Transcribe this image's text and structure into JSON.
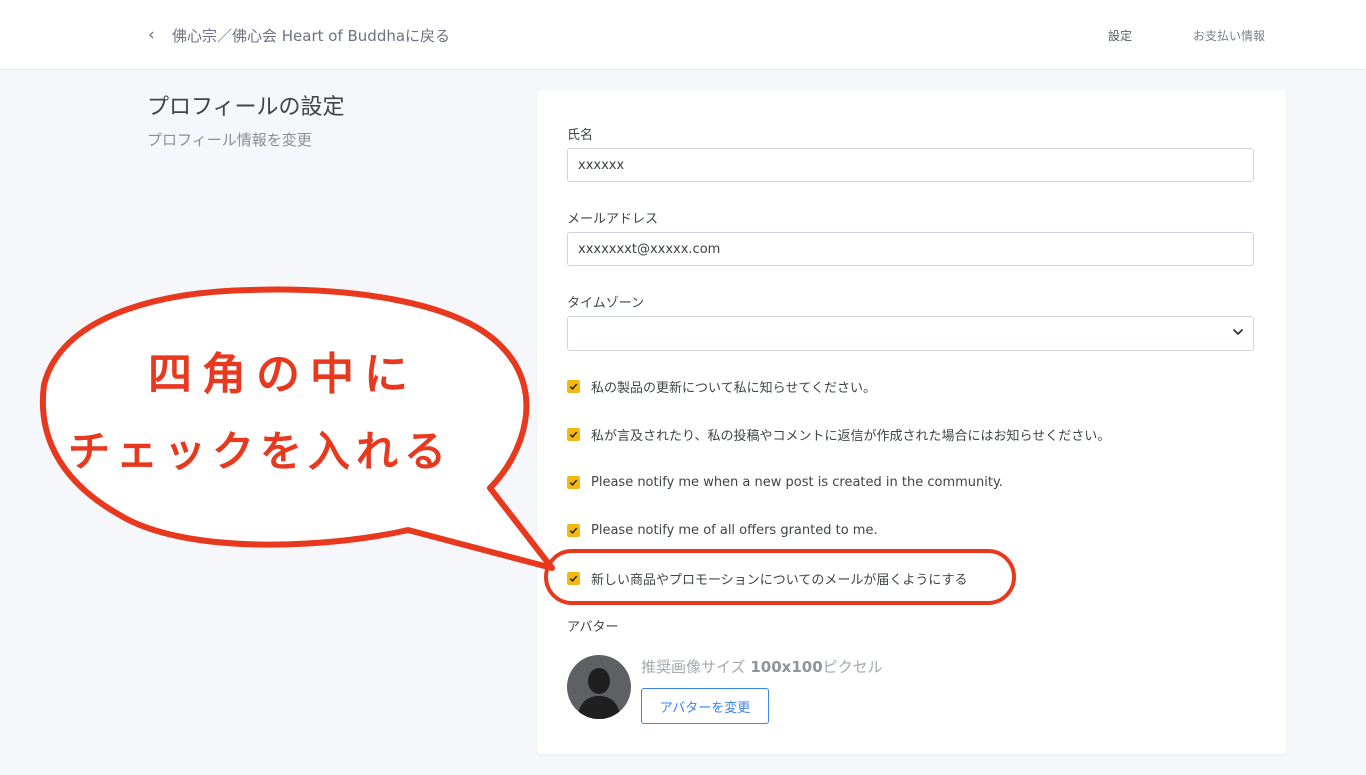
{
  "header": {
    "back_link": "佛心宗／佛心会 Heart of Buddhaに戻る",
    "nav": {
      "settings": "設定",
      "billing": "お支払い情報"
    }
  },
  "section": {
    "title": "プロフィールの設定",
    "subtitle": "プロフィール情報を変更"
  },
  "form": {
    "name": {
      "label": "氏名",
      "value": "xxxxxx"
    },
    "email": {
      "label": "メールアドレス",
      "value": "xxxxxxxt@xxxxx.com"
    },
    "timezone": {
      "label": "タイムゾーン",
      "value": ""
    },
    "checkboxes": [
      {
        "label": "私の製品の更新について私に知らせてください。",
        "checked": true
      },
      {
        "label": "私が言及されたり、私の投稿やコメントに返信が作成された場合にはお知らせください。",
        "checked": true
      },
      {
        "label": "Please notify me when a new post is created in the community.",
        "checked": true
      },
      {
        "label": "Please notify me of all offers granted to me.",
        "checked": true
      },
      {
        "label": "新しい商品やプロモーションについてのメールが届くようにする",
        "checked": true
      }
    ],
    "avatar": {
      "label": "アバター",
      "hint_prefix": "推奨画像サイズ ",
      "hint_size": "100x100",
      "hint_suffix": "ピクセル",
      "button": "アバターを変更"
    }
  },
  "annotation": {
    "callout_line1": "四角の中に",
    "callout_line2": "チェックを入れる",
    "color": "#e8391f"
  },
  "colors": {
    "checkbox": "#f3b913",
    "accent": "#3b82f6",
    "background": "#f5f7fa"
  }
}
